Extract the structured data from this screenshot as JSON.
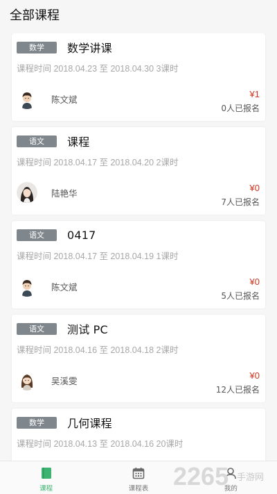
{
  "header": {
    "title": "全部课程"
  },
  "courses": [
    {
      "subject": "数学",
      "title": "数学讲课",
      "time": "课程时间 2018.04.23 至 2018.04.30 3课时",
      "teacher": "陈文斌",
      "avatar_icon": "boy-avatar-icon",
      "price": "¥1",
      "enrolled": "0人已报名"
    },
    {
      "subject": "语文",
      "title": "课程",
      "time": "课程时间 2018.04.17 至 2018.04.20 2课时",
      "teacher": "陆艳华",
      "avatar_icon": "woman-photo-avatar-icon",
      "price": "¥0",
      "enrolled": "7人已报名"
    },
    {
      "subject": "语文",
      "title": "0417",
      "time": "课程时间 2018.04.17 至 2018.04.19 1课时",
      "teacher": "陈文斌",
      "avatar_icon": "boy-avatar-icon",
      "price": "¥0",
      "enrolled": "5人已报名"
    },
    {
      "subject": "语文",
      "title": "测试 PC",
      "time": "课程时间 2018.04.16 至 2018.04.18 2课时",
      "teacher": "吴溪雯",
      "avatar_icon": "girl-avatar-icon",
      "price": "¥0",
      "enrolled": "12人已报名"
    },
    {
      "subject": "数学",
      "title": "几何课程",
      "time": "课程时间 2018.04.13 至 2018.04.16 20课时"
    }
  ],
  "tabbar": {
    "items": [
      {
        "label": "课程",
        "icon": "book-icon",
        "active": true
      },
      {
        "label": "课程表",
        "icon": "calendar-icon",
        "active": false
      },
      {
        "label": "我的",
        "icon": "user-icon",
        "active": false
      }
    ]
  },
  "watermark": {
    "text": "2265",
    "site": "手游网"
  },
  "colors": {
    "accent": "#3cb371",
    "price": "#d0351f",
    "badge": "#7f878d"
  }
}
